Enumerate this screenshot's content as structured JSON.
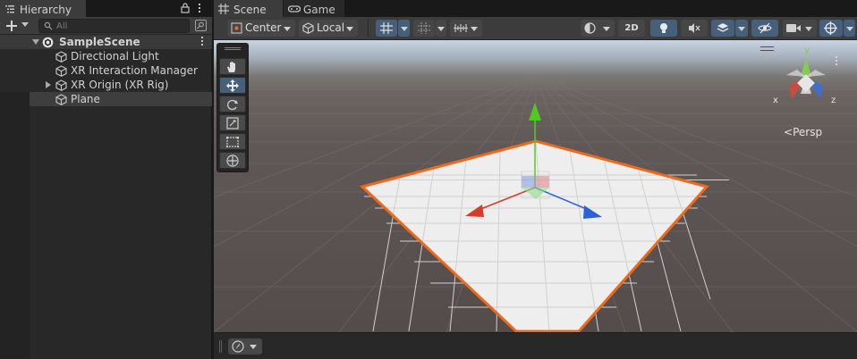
{
  "hierarchy": {
    "tab_label": "Hierarchy",
    "search_placeholder": "All",
    "scene_name": "SampleScene",
    "items": [
      {
        "label": "Directional Light"
      },
      {
        "label": "XR Interaction Manager"
      },
      {
        "label": "XR Origin (XR Rig)"
      },
      {
        "label": "Plane"
      }
    ]
  },
  "scene_view": {
    "tabs": [
      {
        "label": "Scene"
      },
      {
        "label": "Game"
      }
    ],
    "toolbar": {
      "pivot_mode": "Center",
      "pivot_rotation": "Local",
      "mode_2d": "2D"
    },
    "gizmo": {
      "axis_x": "x",
      "axis_y": "y",
      "axis_z": "z",
      "projection": "Persp"
    }
  },
  "colors": {
    "axis_x": "#d63a2a",
    "axis_y": "#4ecb1e",
    "axis_z": "#2a63d6",
    "selection_outline": "#ee6a1b",
    "active_tool": "#46607c"
  }
}
